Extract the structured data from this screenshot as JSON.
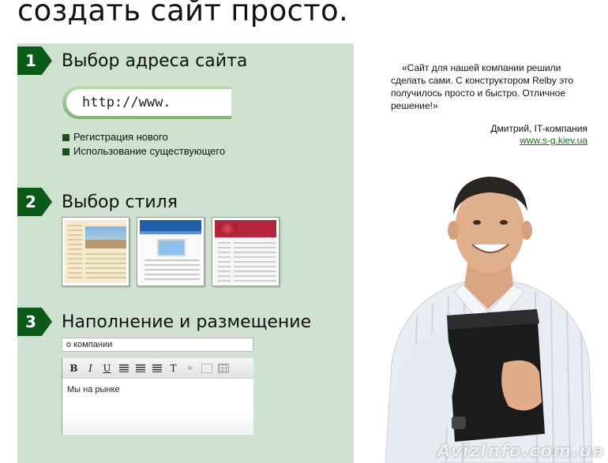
{
  "headline": "создать сайт просто.",
  "steps": [
    {
      "number": "1",
      "title": "Выбор адреса сайта"
    },
    {
      "number": "2",
      "title": "Выбор стиля"
    },
    {
      "number": "3",
      "title": "Наполнение и размещение"
    }
  ],
  "address": {
    "url_value": "http://www.",
    "options": [
      "Регистрация нового",
      "Использование существующего"
    ]
  },
  "style": {
    "thumbnails": [
      "style-template-beach",
      "style-template-blue",
      "style-template-berries"
    ]
  },
  "content": {
    "field_value": "о компании",
    "editor_text": "Мы на рынке",
    "toolbar": [
      "B",
      "I",
      "U"
    ]
  },
  "testimonial": {
    "quote": "«Сайт для нашей компании решили сделать сами. С конструктором Relby это получилось просто и быстро. Отличное решение!»",
    "author": "Дмитрий, IT-компания",
    "link": "www.s-g.kiev.ua"
  },
  "watermark": "AvizInfo.com.ua",
  "colors": {
    "panel": "#cfe1cf",
    "badge": "#0c5a1a",
    "link": "#1a6d1a"
  }
}
